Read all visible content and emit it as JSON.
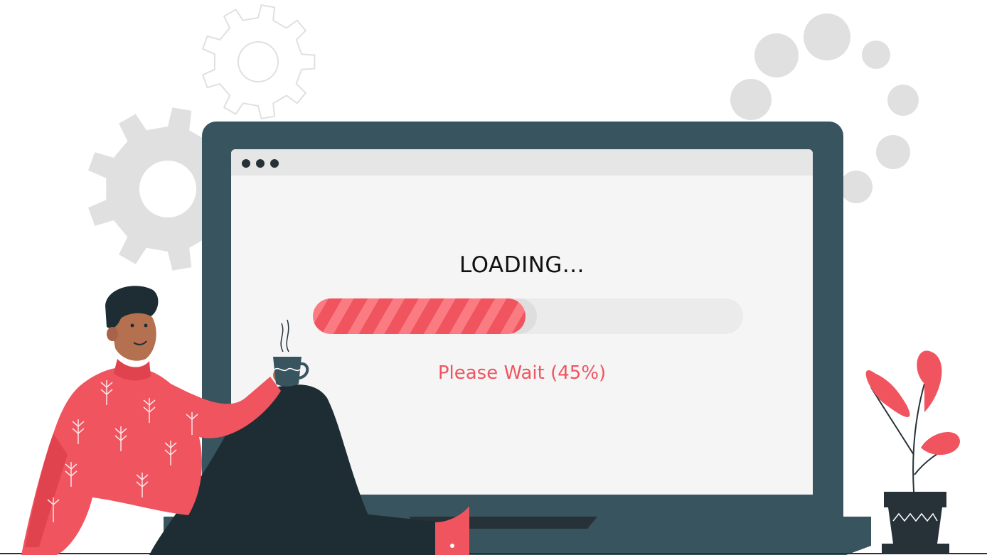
{
  "screen": {
    "loading_label": "LOADING...",
    "wait_label": "Please Wait (45%)",
    "progress": 0.45
  },
  "window_controls": [
    "dot",
    "dot",
    "dot"
  ],
  "colors": {
    "accent": "#f0545f",
    "accent_light": "#fb7b83",
    "bezel": "#37545f",
    "dark": "#263238",
    "screen_bg": "#f5f5f5",
    "track": "#ebebeb",
    "decor_gray": "#e0e0e0"
  },
  "icons": [
    "gear-icon",
    "loading-spinner-icon",
    "coffee-cup-icon",
    "plant-icon"
  ]
}
